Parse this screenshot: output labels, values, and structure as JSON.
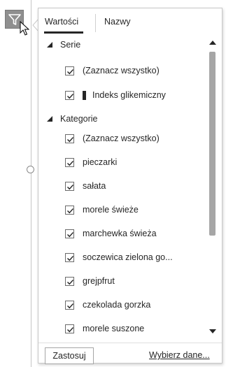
{
  "tabs": [
    {
      "label": "Wartości",
      "selected": true
    },
    {
      "label": "Nazwy",
      "selected": false
    }
  ],
  "series_group": {
    "label": "Serie",
    "expanded": true,
    "items": [
      {
        "label": "(Zaznacz wszystko)",
        "checked": true
      },
      {
        "label": "Indeks glikemiczny",
        "checked": true,
        "swatch_color": "#262626"
      }
    ]
  },
  "categories_group": {
    "label": "Kategorie",
    "expanded": true,
    "items": [
      {
        "label": "(Zaznacz wszystko)",
        "checked": true
      },
      {
        "label": "pieczarki",
        "checked": true
      },
      {
        "label": "sałata",
        "checked": true
      },
      {
        "label": "morele świeże",
        "checked": true
      },
      {
        "label": "marchewka świeża",
        "checked": true
      },
      {
        "label": "soczewica zielona go...",
        "checked": true
      },
      {
        "label": "grejpfrut",
        "checked": true
      },
      {
        "label": "czekolada gorzka",
        "checked": true
      },
      {
        "label": "morele suszone",
        "checked": true
      }
    ]
  },
  "footer": {
    "apply_label": "Zastosuj",
    "select_data_label": "Wybierz dane..."
  },
  "colors": {
    "filter_button_bg": "#8f8f8f",
    "text": "#262626",
    "scroll_thumb": "#a6a6a6"
  },
  "icons": {
    "filter_button": "funnel-icon",
    "group_toggle": "triangle-expanded-icon",
    "checkbox": "checkmark-icon"
  }
}
